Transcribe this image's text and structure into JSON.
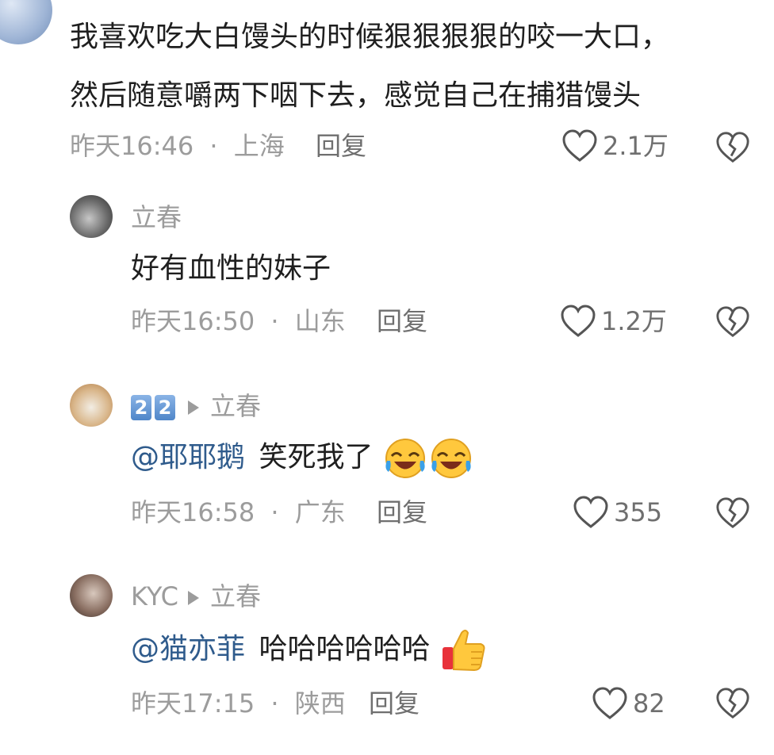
{
  "comments": [
    {
      "text_line1": "我喜欢吃大白馒头的时候狠狠狠狠的咬一大口，",
      "text_line2": "然后随意嚼两下咽下去，感觉自己在捕猎馒头",
      "time": "昨天16:46",
      "location": "上海",
      "reply_label": "回复",
      "likes": "2.1万"
    },
    {
      "username": "立春",
      "text": "好有血性的妹子",
      "time": "昨天16:50",
      "location": "山东",
      "reply_label": "回复",
      "likes": "1.2万"
    },
    {
      "username_badges": [
        "2",
        "2"
      ],
      "reply_to": "立春",
      "mention": "@耶耶鹅",
      "text": "笑死我了",
      "emoji": "laughing-crying-emoji",
      "time": "昨天16:58",
      "location": "广东",
      "reply_label": "回复",
      "likes": "355"
    },
    {
      "username": "KYC",
      "reply_to": "立春",
      "mention": "@猫亦菲",
      "text": "哈哈哈哈哈哈",
      "emoji": "thumbs-up-emoji",
      "time": "昨天17:15",
      "location": "陕西",
      "reply_label": "回复",
      "likes": "82"
    }
  ],
  "separator": "·",
  "colors": {
    "mention": "#2f5b8c",
    "meta": "#9c9c9c",
    "text": "#1f1f1f"
  }
}
